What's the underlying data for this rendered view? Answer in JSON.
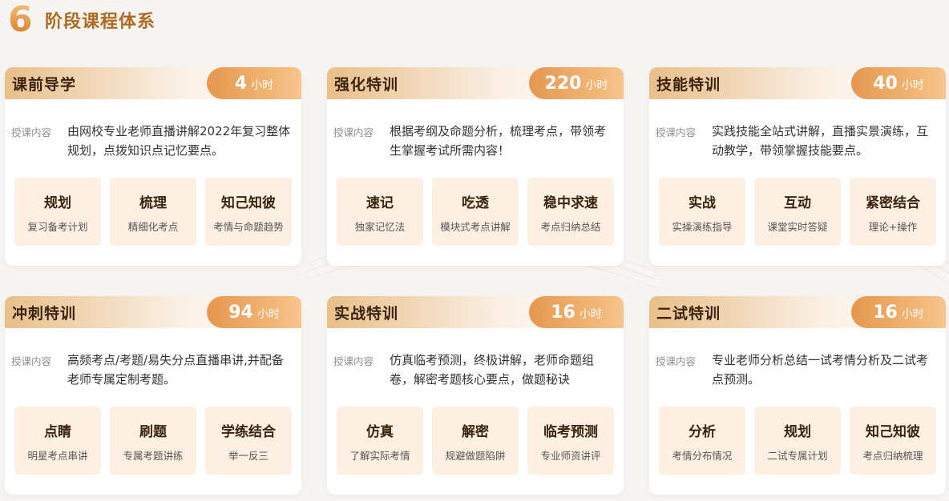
{
  "heading": {
    "number": "6",
    "title": "阶段课程体系"
  },
  "desc_label": "授课内容",
  "hours_unit": "小时",
  "cards": [
    {
      "title": "课前导学",
      "hours": "4",
      "desc": "由网校专业老师直播讲解2022年复习整体规划，点拨知识点记忆要点。",
      "boxes": [
        {
          "t": "规划",
          "s": "复习备考计划"
        },
        {
          "t": "梳理",
          "s": "精细化考点"
        },
        {
          "t": "知己知彼",
          "s": "考情与命题趋势"
        }
      ]
    },
    {
      "title": "强化特训",
      "hours": "220",
      "desc": "根据考纲及命题分析，梳理考点，带领考生掌握考试所需内容！",
      "boxes": [
        {
          "t": "速记",
          "s": "独家记忆法"
        },
        {
          "t": "吃透",
          "s": "模块式考点讲解"
        },
        {
          "t": "稳中求速",
          "s": "考点归纳总结"
        }
      ]
    },
    {
      "title": "技能特训",
      "hours": "40",
      "desc": "实践技能全站式讲解，直播实景演练，互动教学，带领掌握技能要点。",
      "boxes": [
        {
          "t": "实战",
          "s": "实操演练指导"
        },
        {
          "t": "互动",
          "s": "课堂实时答疑"
        },
        {
          "t": "紧密结合",
          "s": "理论+操作"
        }
      ]
    },
    {
      "title": "冲刺特训",
      "hours": "94",
      "desc": "高频考点/考题/易失分点直播串讲,并配备老师专属定制考题。",
      "boxes": [
        {
          "t": "点睛",
          "s": "明星考点串讲"
        },
        {
          "t": "刷题",
          "s": "专属考题讲练"
        },
        {
          "t": "学练结合",
          "s": "举一反三"
        }
      ]
    },
    {
      "title": "实战特训",
      "hours": "16",
      "desc": "仿真临考预测，终极讲解，老师命题组卷，解密考题核心要点，做题秘诀",
      "boxes": [
        {
          "t": "仿真",
          "s": "了解实际考情"
        },
        {
          "t": "解密",
          "s": "规避做题陷阱"
        },
        {
          "t": "临考预测",
          "s": "专业师资讲评"
        }
      ]
    },
    {
      "title": "二试特训",
      "hours": "16",
      "desc": "专业老师分析总结一试考情分析及二试考点预测。",
      "boxes": [
        {
          "t": "分析",
          "s": "考情分布情况"
        },
        {
          "t": "规划",
          "s": "二试专属计划"
        },
        {
          "t": "知己知彼",
          "s": "考点归纳梳理"
        }
      ]
    }
  ]
}
